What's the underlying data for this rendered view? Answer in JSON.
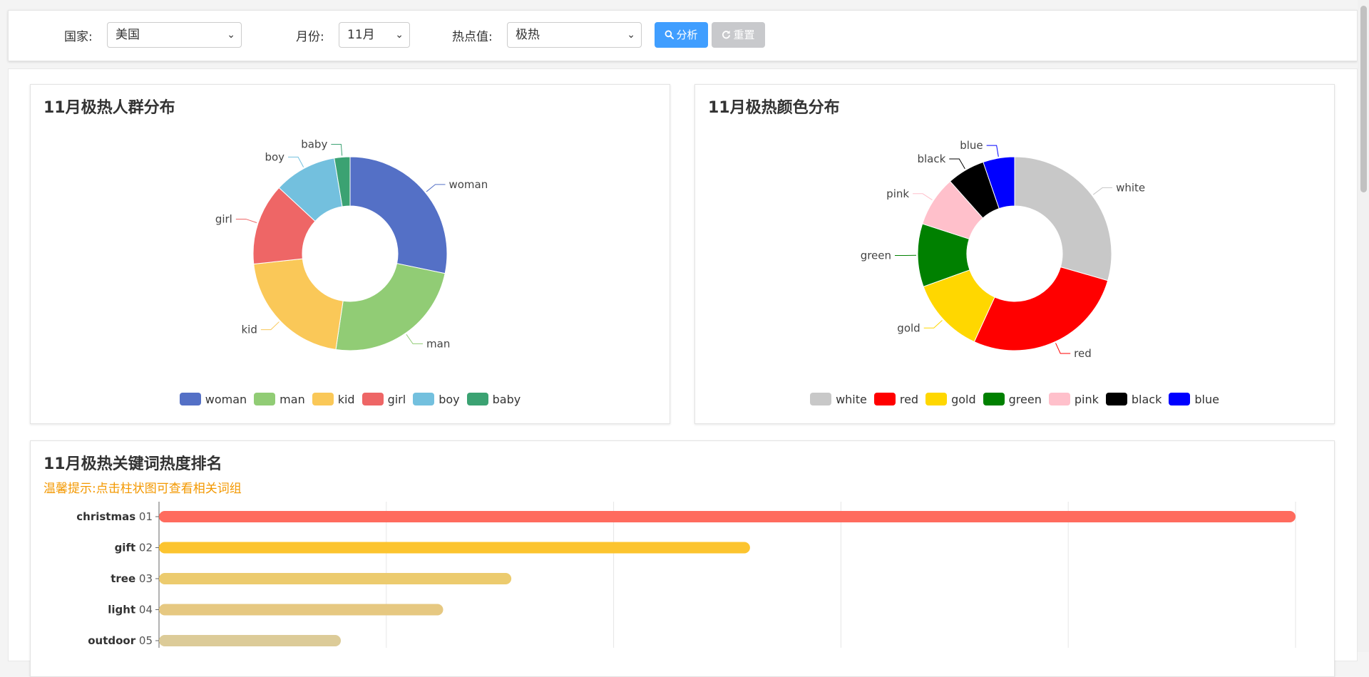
{
  "filters": {
    "country_label": "国家:",
    "country_value": "美国",
    "month_label": "月份:",
    "month_value": "11月",
    "heat_label": "热点值:",
    "heat_value": "极热",
    "analyze_label": "分析",
    "reset_label": "重置"
  },
  "people_panel": {
    "title": "11月极热人群分布",
    "chart_data": {
      "type": "pie",
      "donut": true,
      "legend_position": "bottom",
      "labels": [
        "woman",
        "man",
        "kid",
        "girl",
        "boy",
        "baby"
      ],
      "values": [
        27,
        23,
        20,
        13,
        10,
        2.5
      ],
      "colors": [
        "#5470c6",
        "#91cc75",
        "#fac858",
        "#ee6666",
        "#73c0de",
        "#3ba272"
      ]
    }
  },
  "color_panel": {
    "title": "11月极热颜色分布",
    "chart_data": {
      "type": "pie",
      "donut": true,
      "legend_position": "bottom",
      "labels": [
        "white",
        "red",
        "gold",
        "green",
        "pink",
        "black",
        "blue"
      ],
      "values": [
        28,
        26,
        12,
        10,
        8,
        6,
        5
      ],
      "colors": [
        "#c8c8c8",
        "#ff0000",
        "#ffd700",
        "#008000",
        "#ffc0cb",
        "#000000",
        "#0000ff"
      ]
    }
  },
  "keyword_panel": {
    "title": "11月极热关键词热度排名",
    "hint": "温馨提示:点击柱状图可查看相关词组",
    "chart_data": {
      "type": "bar",
      "orientation": "horizontal",
      "grid": true,
      "xlim": [
        0,
        100
      ],
      "categories": [
        "christmas",
        "gift",
        "tree",
        "light",
        "outdoor"
      ],
      "ranks": [
        "01",
        "02",
        "03",
        "04",
        "05"
      ],
      "values": [
        100,
        52,
        31,
        25,
        16
      ],
      "colors": [
        "#ff6b5e",
        "#fcc42f",
        "#eccb6e",
        "#e6c881",
        "#dccb98"
      ]
    }
  }
}
